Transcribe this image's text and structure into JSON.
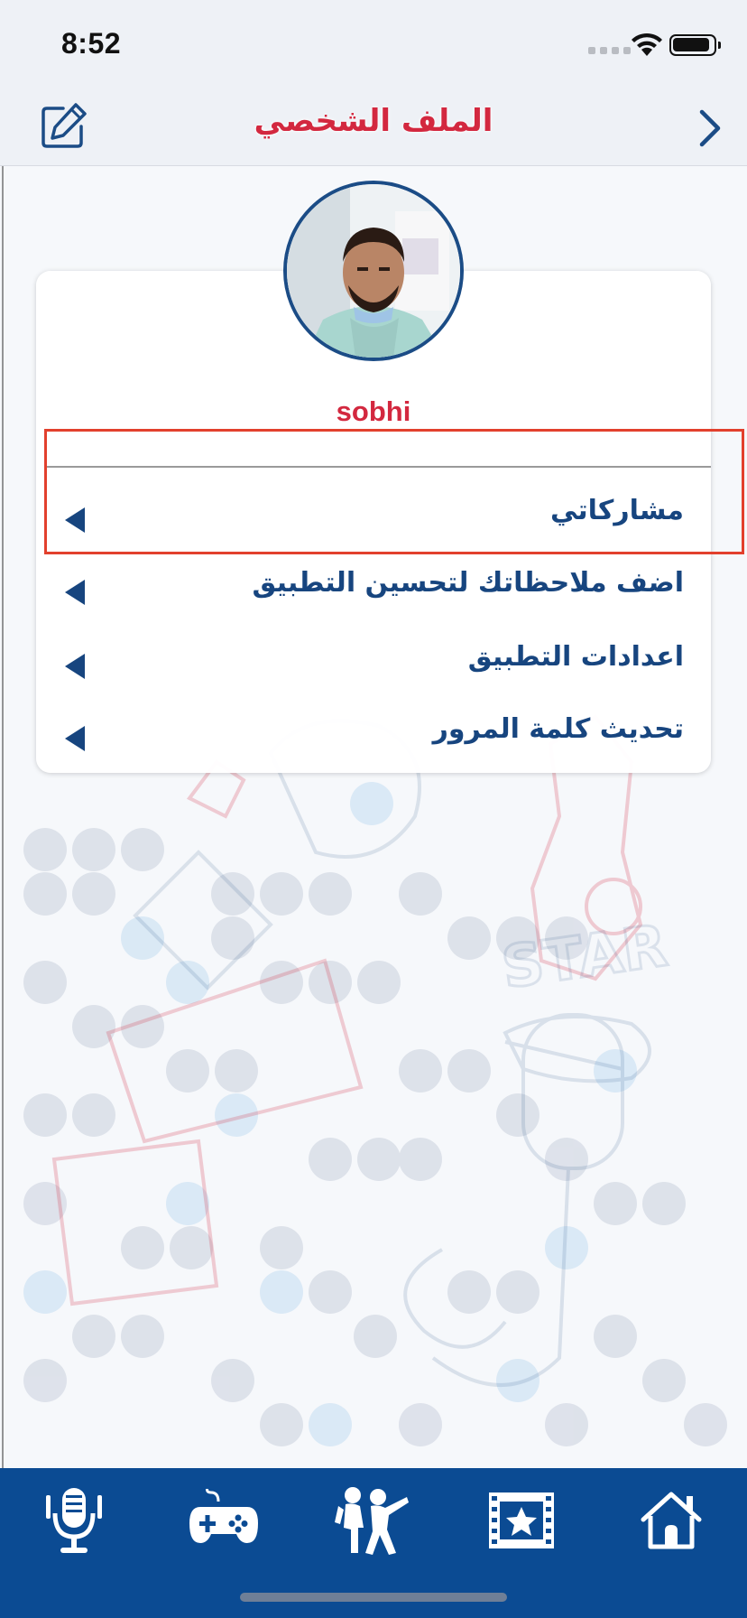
{
  "status_bar": {
    "time": "8:52",
    "icons": [
      "cellular-signal-icon",
      "wifi-icon",
      "battery-icon"
    ]
  },
  "nav": {
    "title": "الملف الشخصي",
    "left_icon": "edit-icon",
    "right_icon": "chevron-right-icon"
  },
  "profile": {
    "avatar": "avatar-photo",
    "name": "sobhi"
  },
  "menu": {
    "items": [
      {
        "label": "مشاركاتي",
        "icon": "triangle-left-icon"
      },
      {
        "label": "اضف ملاحظاتك لتحسين التطبيق",
        "icon": "triangle-left-icon"
      },
      {
        "label": "اعدادات التطبيق",
        "icon": "triangle-left-icon"
      },
      {
        "label": "تحديث كلمة المرور",
        "icon": "triangle-left-icon"
      }
    ]
  },
  "tab_bar": {
    "tabs": [
      {
        "icon": "microphone-icon"
      },
      {
        "icon": "gamepad-icon"
      },
      {
        "icon": "dancers-icon"
      },
      {
        "icon": "film-star-icon"
      },
      {
        "icon": "home-icon"
      }
    ]
  },
  "colors": {
    "accent_red": "#d3283f",
    "primary_blue": "#17457f",
    "tab_bar_blue": "#0b4b93",
    "highlight_red": "#e2402d"
  }
}
